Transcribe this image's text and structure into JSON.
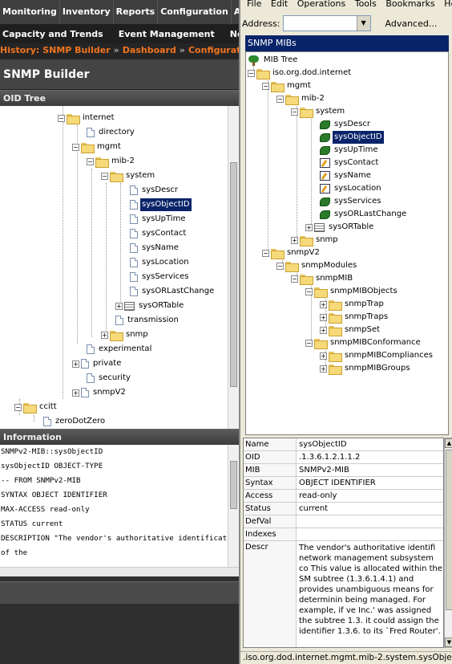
{
  "top_nav": {
    "tabs": [
      "Monitoring",
      "Inventory",
      "Reports",
      "Configuration",
      "A"
    ]
  },
  "sub_nav": {
    "items": [
      "Capacity and Trends",
      "Event Management",
      "Not S"
    ]
  },
  "history": {
    "label": "History:",
    "items": [
      "SNMP Builder",
      "Dashboard",
      "Configuration of G"
    ]
  },
  "page_title": "SNMP Builder",
  "oid_tree": {
    "title": "OID Tree",
    "nodes": [
      "internet",
      "directory",
      "mgmt",
      "mib-2",
      "system",
      "sysDescr",
      "sysObjectID",
      "sysUpTime",
      "sysContact",
      "sysName",
      "sysLocation",
      "sysServices",
      "sysORLastChange",
      "sysORTable",
      "transmission",
      "snmp",
      "experimental",
      "private",
      "security",
      "snmpV2",
      "ccitt",
      "zeroDotZero"
    ],
    "selected": "sysObjectID"
  },
  "information": {
    "title": "Information",
    "lines": [
      "SNMPv2-MIB::sysObjectID",
      "sysObjectID OBJECT-TYPE",
      "  -- FROM SNMPv2-MIB",
      "SYNTAX OBJECT IDENTIFIER",
      "MAX-ACCESS read-only",
      "STATUS current",
      "DESCRIPTION \"The vendor's authoritative identification",
      "of the"
    ]
  },
  "browser": {
    "menu": [
      "File",
      "Edit",
      "Operations",
      "Tools",
      "Bookmarks",
      "Help"
    ],
    "address_label": "Address:",
    "address_value": "",
    "advanced_label": "Advanced..."
  },
  "mib_tree": {
    "title": "SNMP MIBs",
    "nodes": [
      "MIB Tree",
      "iso.org.dod.internet",
      "mgmt",
      "mib-2",
      "system",
      "sysDescr",
      "sysObjectID",
      "sysUpTime",
      "sysContact",
      "sysName",
      "sysLocation",
      "sysServices",
      "sysORLastChange",
      "sysORTable",
      "snmp",
      "snmpV2",
      "snmpModules",
      "snmpMIB",
      "snmpMIBObjects",
      "snmpTrap",
      "snmpTraps",
      "snmpSet",
      "snmpMIBConformance",
      "snmpMIBCompliances",
      "snmpMIBGroups"
    ],
    "selected": "sysObjectID"
  },
  "properties": {
    "rows": [
      {
        "name": "Name",
        "value": "sysObjectID"
      },
      {
        "name": "OID",
        "value": ".1.3.6.1.2.1.1.2"
      },
      {
        "name": "MIB",
        "value": "SNMPv2-MIB"
      },
      {
        "name": "Syntax",
        "value": "OBJECT IDENTIFIER"
      },
      {
        "name": "Access",
        "value": "read-only"
      },
      {
        "name": "Status",
        "value": "current"
      },
      {
        "name": "DefVal",
        "value": ""
      },
      {
        "name": "Indexes",
        "value": ""
      },
      {
        "name": "Descr",
        "value": "The vendor's authoritative identifi network management subsystem co This value is allocated within the SM subtree (1.3.6.1.4.1) and provides unambiguous means for determinin being managed.  For example, if ve Inc.' was assigned the subtree 1.3. it could assign the identifier 1.3.6. to its `Fred Router'."
      }
    ]
  },
  "status_bar": ".iso.org.dod.internet.mgmt.mib-2.system.sysObjectID",
  "colors": {
    "accent_orange": "#f0741f",
    "selection": "#0a246a",
    "header_dark": "#444444"
  }
}
